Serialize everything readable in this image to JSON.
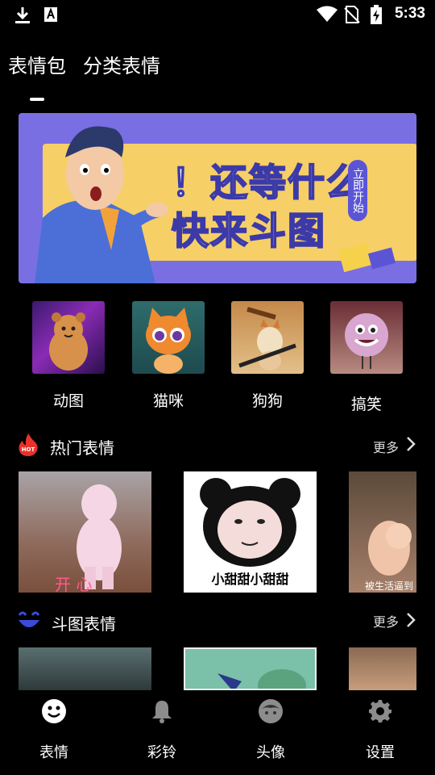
{
  "status_bar": {
    "time": "5:33",
    "icons": [
      "download-icon",
      "a-keyboard-icon",
      "wifi-icon",
      "no-sim-icon",
      "battery-charging-icon"
    ]
  },
  "top_tabs": [
    {
      "label": "表情包",
      "active": true
    },
    {
      "label": "分类表情",
      "active": false
    }
  ],
  "banner": {
    "line1": "！还等什么",
    "line2": "快来斗图",
    "tag": "立即开始"
  },
  "categories": [
    {
      "label": "动图",
      "icon": "bear-character"
    },
    {
      "label": "猫咪",
      "icon": "cat-character"
    },
    {
      "label": "狗狗",
      "icon": "dog-character"
    },
    {
      "label": "搞笑",
      "icon": "fluffy-monster"
    }
  ],
  "sections": {
    "hot": {
      "title": "热门表情",
      "more": "更多",
      "icon": "hot-flame-icon",
      "items": [
        {
          "caption": "开 心"
        },
        {
          "caption": "小甜甜小甜甜"
        },
        {
          "caption": "被生活逼到"
        }
      ]
    },
    "battle": {
      "title": "斗图表情",
      "more": "更多",
      "icon": "smile-face-icon"
    }
  },
  "bottom_nav": [
    {
      "label": "表情",
      "icon": "smiley-icon"
    },
    {
      "label": "彩铃",
      "icon": "bell-icon"
    },
    {
      "label": "头像",
      "icon": "avatar-icon"
    },
    {
      "label": "设置",
      "icon": "gear-icon"
    }
  ],
  "colors": {
    "background": "#000000",
    "banner_purple": "#7a6fe2",
    "banner_yellow": "#f6cf67",
    "hot_red": "#e8322b",
    "battle_blue": "#3b4bd8"
  }
}
